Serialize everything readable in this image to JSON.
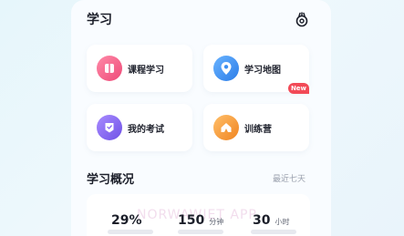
{
  "header": {
    "title": "学习",
    "settings_icon": "settings-icon"
  },
  "cards": [
    {
      "label": "课程学习",
      "icon": "book-icon",
      "color": "#f35d88"
    },
    {
      "label": "学习地图",
      "icon": "map-pin-icon",
      "color": "#3d8ff0",
      "badge": "New"
    },
    {
      "label": "我的考试",
      "icon": "exam-icon",
      "color": "#8a6cf2"
    },
    {
      "label": "训练营",
      "icon": "camp-icon",
      "color": "#f59a3b"
    }
  ],
  "overview": {
    "title": "学习概况",
    "range": "最近七天",
    "watermark": "NORWAWIET APP",
    "stats": [
      {
        "value": "29%",
        "unit": ""
      },
      {
        "value": "150",
        "unit": "分钟"
      },
      {
        "value": "30",
        "unit": "小时"
      }
    ]
  }
}
